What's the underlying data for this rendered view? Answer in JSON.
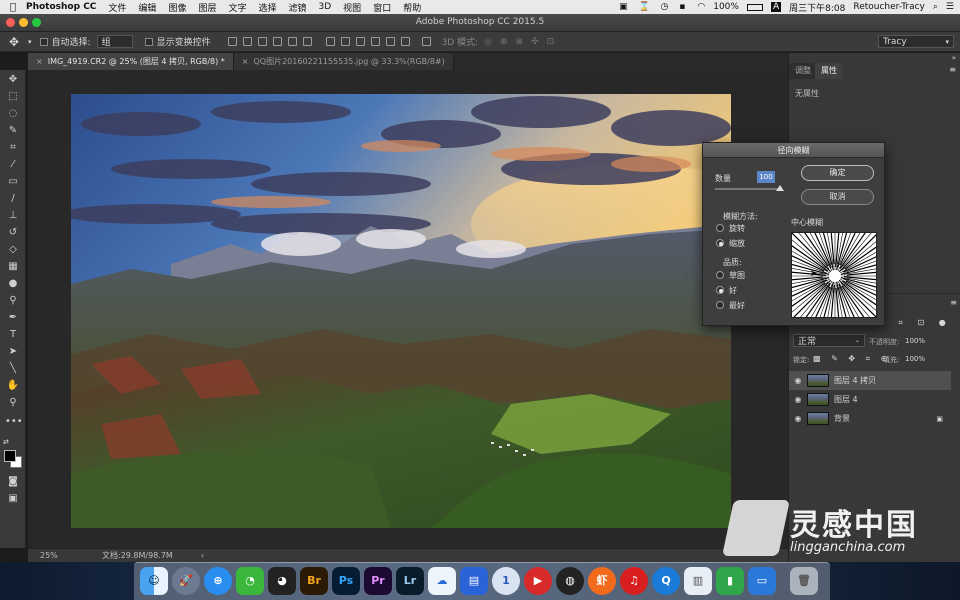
{
  "menubar": {
    "app": "Photoshop CC",
    "items": [
      "文件",
      "编辑",
      "图像",
      "图层",
      "文字",
      "选择",
      "滤镜",
      "3D",
      "视图",
      "窗口",
      "帮助"
    ],
    "battery": "100%",
    "clock": "周三下午8:08",
    "user": "Retoucher-Tracy"
  },
  "window": {
    "title": "Adobe Photoshop CC 2015.5"
  },
  "options": {
    "auto_select_label": "自动选择:",
    "auto_select_value": "组",
    "show_transform_label": "显示变换控件",
    "mode3d_label": "3D 模式:",
    "workspace": "Tracy"
  },
  "tabs": [
    {
      "label": "IMG_4919.CR2 @ 25% (图层 4 拷贝, RGB/8) *"
    },
    {
      "label": "QQ图片20160221155535.jpg @ 33.3%(RGB/8#)"
    }
  ],
  "status": {
    "zoom": "25%",
    "doc": "文档:29.8M/98.7M"
  },
  "panels": {
    "tab_adjust": "调整",
    "tab_props": "属性",
    "no_props": "无属性"
  },
  "layers": {
    "blend_mode": "正常",
    "opacity_label": "不透明度:",
    "opacity_value": "100%",
    "lock_label": "锁定:",
    "fill_label": "填充:",
    "fill_value": "100%",
    "items": [
      {
        "name": "图层 4 拷贝",
        "selected": true
      },
      {
        "name": "图层 4",
        "selected": false
      },
      {
        "name": "背景",
        "selected": false,
        "locked": true
      }
    ]
  },
  "dialog": {
    "title": "径向模糊",
    "amount_label": "数量",
    "amount_value": "100",
    "ok": "确定",
    "cancel": "取消",
    "method_label": "模糊方法:",
    "method_spin": "旋转",
    "method_zoom": "缩放",
    "method_selected": "缩放",
    "quality_label": "品质:",
    "q_draft": "草图",
    "q_good": "好",
    "q_best": "最好",
    "quality_selected": "好",
    "center_label": "中心模糊"
  },
  "watermark": {
    "main": "灵感中国",
    "sub": "lingganchina.com"
  },
  "dock": [
    "Finder",
    "Launchpad",
    "Safari",
    "WeChat",
    "QQ",
    "Br",
    "Ps",
    "Pr",
    "Lr",
    "Baidu",
    "Screen",
    "1Password",
    "Music",
    "OBS",
    "Shrimp",
    "NetEase",
    "Q",
    "Preview",
    "Numbers",
    "Keynote",
    "Trash"
  ]
}
